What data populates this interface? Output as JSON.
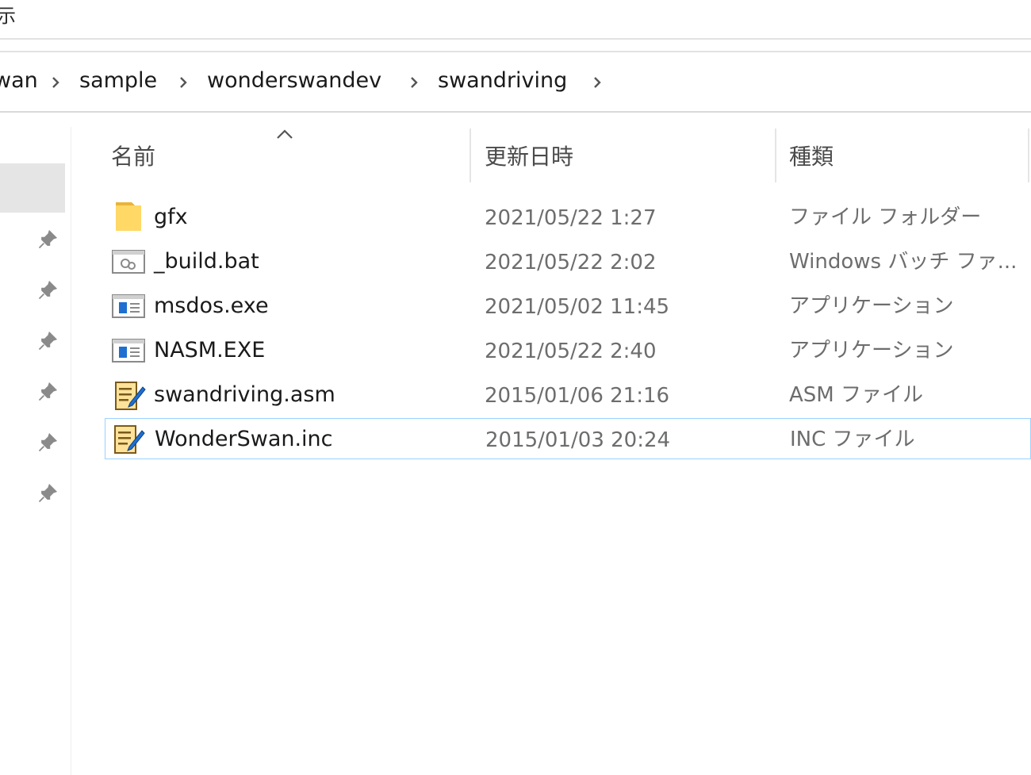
{
  "ribbon": {
    "partial_label": "示"
  },
  "breadcrumb": {
    "items": [
      {
        "label": "wan"
      },
      {
        "label": "sample"
      },
      {
        "label": "wonderswandev"
      },
      {
        "label": "swandriving"
      }
    ]
  },
  "columns": {
    "name": "名前",
    "date": "更新日時",
    "type": "種類",
    "sort_indicator": "chevron-up-icon"
  },
  "files": [
    {
      "icon": "folder-icon",
      "name": "gfx",
      "date": "2021/05/22 1:27",
      "type": "ファイル フォルダー"
    },
    {
      "icon": "batch-file-icon",
      "name": "_build.bat",
      "date": "2021/05/22 2:02",
      "type": "Windows バッチ ファ..."
    },
    {
      "icon": "exe-file-icon",
      "name": "msdos.exe",
      "date": "2021/05/02 11:45",
      "type": "アプリケーション"
    },
    {
      "icon": "exe-file-icon",
      "name": "NASM.EXE",
      "date": "2021/05/22 2:40",
      "type": "アプリケーション"
    },
    {
      "icon": "text-file-icon",
      "name": "swandriving.asm",
      "date": "2015/01/06 21:16",
      "type": "ASM ファイル"
    },
    {
      "icon": "text-file-icon",
      "name": "WonderSwan.inc",
      "date": "2015/01/03 20:24",
      "type": "INC ファイル"
    }
  ],
  "colors": {
    "selection_border": "#99d1ff",
    "nav_selected": "#e5e5e5",
    "folder": "#ffd866"
  }
}
